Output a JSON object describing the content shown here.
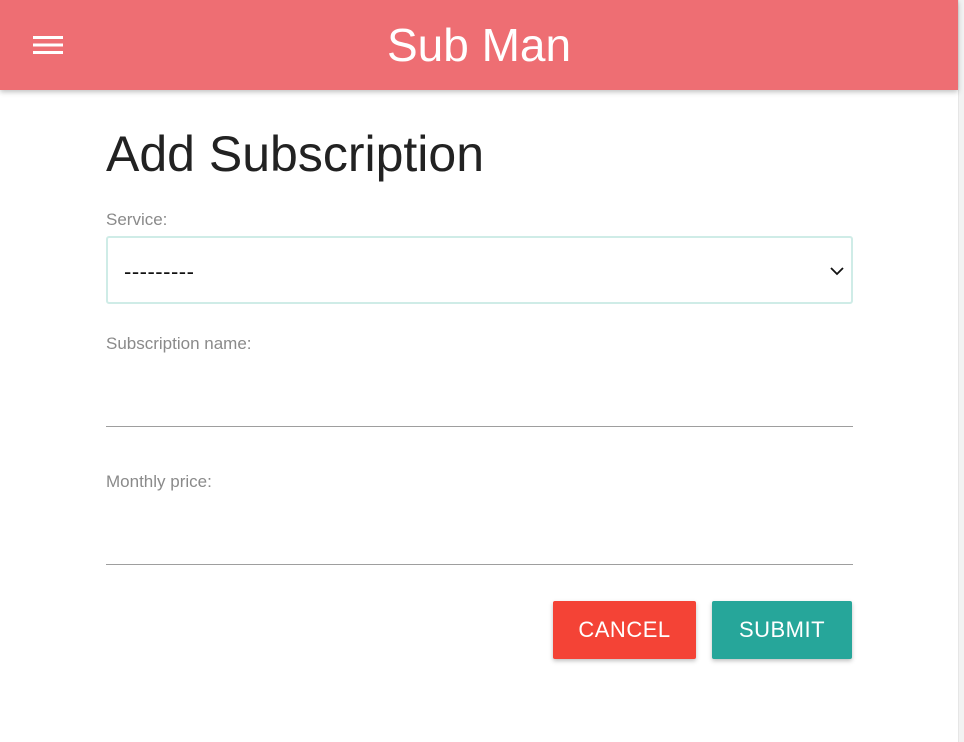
{
  "navbar": {
    "brand": "Sub Man",
    "menu_icon": "hamburger-menu-icon",
    "color": "#ee6e73"
  },
  "form": {
    "title": "Add Subscription",
    "service": {
      "label": "Service:",
      "selected": "---------"
    },
    "subscription_name": {
      "label": "Subscription name:",
      "value": ""
    },
    "monthly_price": {
      "label": "Monthly price:",
      "value": ""
    },
    "buttons": {
      "cancel": "CANCEL",
      "submit": "SUBMIT"
    }
  },
  "colors": {
    "cancel": "#f44336",
    "submit": "#26a69a",
    "select_border": "#cfece7"
  }
}
